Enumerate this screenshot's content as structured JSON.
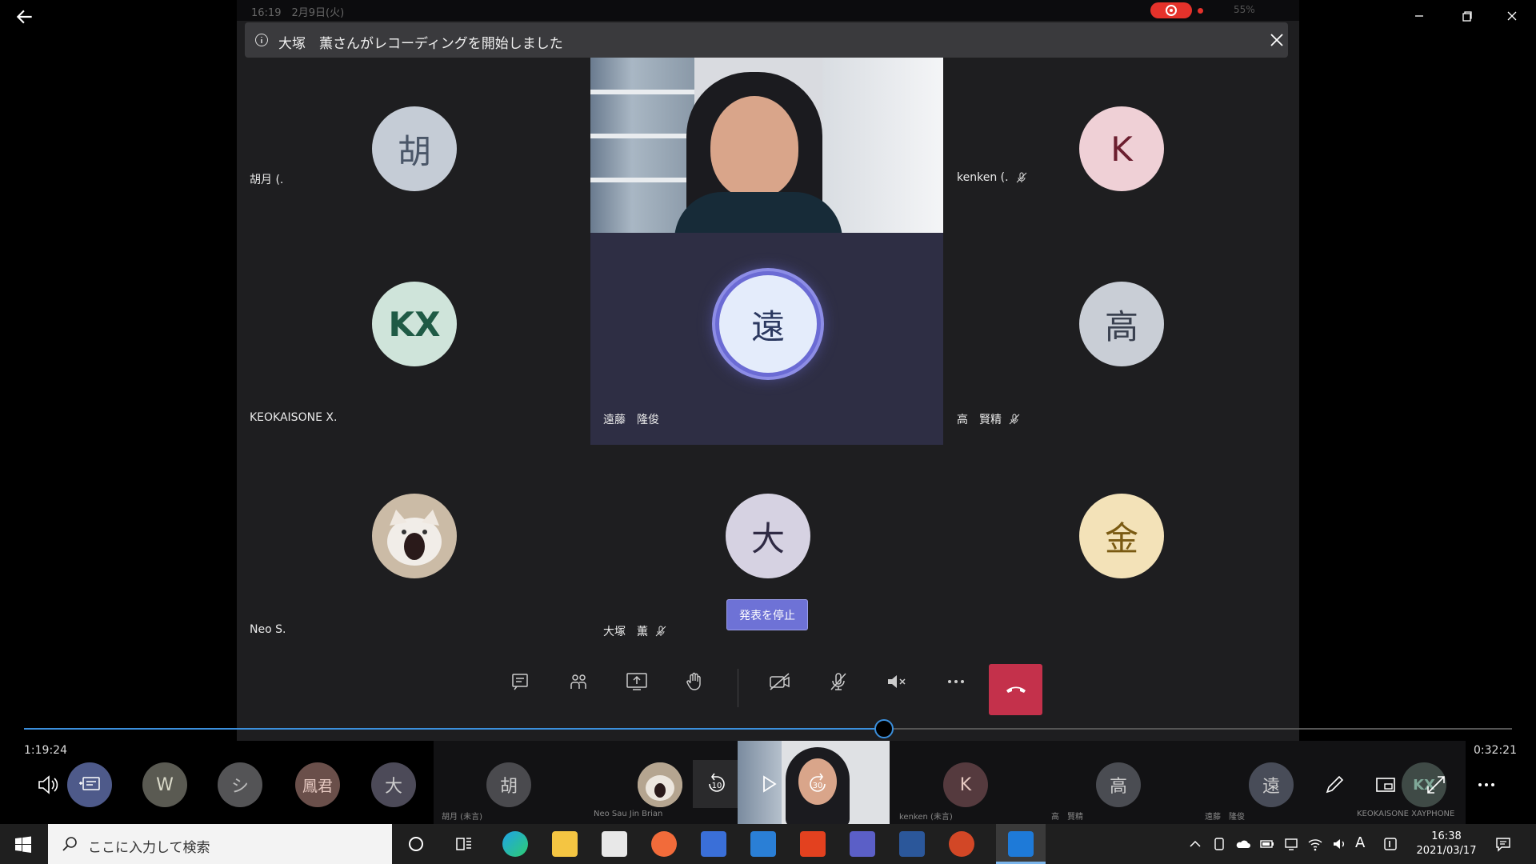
{
  "tablet_status": {
    "time_date": "16:19　2月9日(火)",
    "battery": "55%"
  },
  "banner": {
    "message": "大塚　薫さんがレコーディングを開始しました"
  },
  "tiles": [
    {
      "name": "胡月 (.",
      "initial": "胡",
      "bg": "#c5ccd6",
      "fg": "#4a5668",
      "mic_off": false
    },
    {
      "name": "kenken (.",
      "initial": "K",
      "bg": "#efd0d6",
      "fg": "#6b1e2f",
      "mic_off": true
    },
    {
      "name": "KEOKAISONE X.",
      "initial": "KX",
      "bg": "#cfe4da",
      "fg": "#1f5a45",
      "mic_off": false
    },
    {
      "name": "遠藤　隆俊",
      "initial": "遠",
      "bg": "#e4ecfb",
      "fg": "#2b3860",
      "mic_off": false
    },
    {
      "name": "高　賢精",
      "initial": "高",
      "bg": "#c9ced6",
      "fg": "#3a4150",
      "mic_off": true
    },
    {
      "name": "Neo S.",
      "initial": "",
      "bg": "#d8cfc4",
      "fg": "#333",
      "mic_off": false
    },
    {
      "name": "大塚　薫",
      "initial": "大",
      "bg": "#d6d2e2",
      "fg": "#2f2a44",
      "mic_off": true
    },
    {
      "name": "",
      "initial": "金",
      "bg": "#f3e2b8",
      "fg": "#7a5a12",
      "mic_off": false
    }
  ],
  "stop_presenting": "発表を停止",
  "playback": {
    "elapsed": "1:19:24",
    "remaining": "0:32:21",
    "progress": 0.578
  },
  "strip": {
    "avatars": [
      {
        "initial": "W",
        "bg": "#5a5a52",
        "fg": "#d8d8c8"
      },
      {
        "initial": "シ",
        "bg": "#545456",
        "fg": "#bbb"
      },
      {
        "initial": "鳳君",
        "bg": "#6a4f4a",
        "fg": "#e6c9c1"
      },
      {
        "initial": "大",
        "bg": "#4c4a58",
        "fg": "#ccc"
      }
    ],
    "participants": [
      {
        "initial": "胡",
        "label": "胡月 (未言)"
      },
      {
        "initial": "",
        "label": "Neo Sau Jin Brian"
      },
      {
        "initial": "K",
        "label": "kenken (未言)"
      },
      {
        "initial": "高",
        "label": "高　賢精"
      },
      {
        "initial": "遠",
        "label": "遠藤　隆俊"
      },
      {
        "initial": "KX",
        "label": "KEOKAISONE XAYPHONE"
      }
    ],
    "rewind_label": "10",
    "forward_label": "30"
  },
  "taskbar": {
    "search_placeholder": "ここに入力して検索",
    "clock_time": "16:38",
    "clock_date": "2021/03/17",
    "ime": "A"
  },
  "colors": {
    "accent": "#3b8fdc",
    "hangup": "#c4314b",
    "teams": "#6e72d6"
  }
}
